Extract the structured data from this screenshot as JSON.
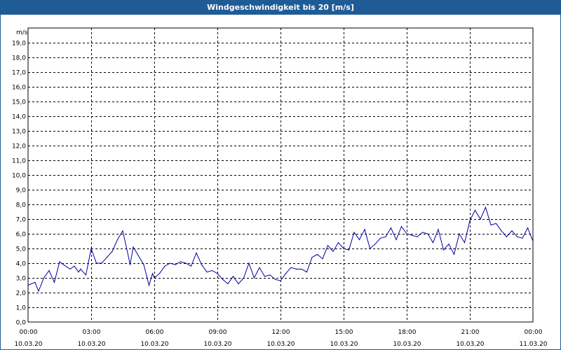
{
  "window": {
    "title": "Windgeschwindigkeit bis 20 [m/s]"
  },
  "colors": {
    "titlebar": "#1f5c96",
    "series": "#0000a0",
    "grid": "#000000"
  },
  "chart_data": {
    "type": "line",
    "title": "Windgeschwindigkeit bis 20 [m/s]",
    "ylabel": "m/s",
    "xlabel": "",
    "ylim": [
      0,
      20
    ],
    "xlim": [
      0,
      24
    ],
    "grid": true,
    "y_ticks": [
      "0,0",
      "1,0",
      "2,0",
      "3,0",
      "4,0",
      "5,0",
      "6,0",
      "7,0",
      "8,0",
      "9,0",
      "10,0",
      "11,0",
      "12,0",
      "13,0",
      "14,0",
      "15,0",
      "16,0",
      "17,0",
      "18,0",
      "19,0"
    ],
    "x_ticks": [
      {
        "time": "00:00",
        "date": "10.03.20"
      },
      {
        "time": "03:00",
        "date": "10.03.20"
      },
      {
        "time": "06:00",
        "date": "10.03.20"
      },
      {
        "time": "09:00",
        "date": "10.03.20"
      },
      {
        "time": "12:00",
        "date": "10.03.20"
      },
      {
        "time": "15:00",
        "date": "10.03.20"
      },
      {
        "time": "18:00",
        "date": "10.03.20"
      },
      {
        "time": "21:00",
        "date": "10.03.20"
      },
      {
        "time": "00:00",
        "date": "11.03.20"
      }
    ],
    "series": [
      {
        "x": [
          0,
          0.33,
          0.5,
          0.75,
          1.0,
          1.25,
          1.5,
          1.58,
          2.0,
          2.2,
          2.4,
          2.5,
          2.75,
          3.0,
          3.25,
          3.5,
          3.75,
          4.0,
          4.25,
          4.5,
          4.75,
          4.85,
          5.0,
          5.25,
          5.5,
          5.75,
          5.92,
          6.0,
          6.25,
          6.5,
          6.75,
          7.0,
          7.25,
          7.5,
          7.75,
          8.0,
          8.25,
          8.5,
          8.75,
          9.0,
          9.25,
          9.5,
          9.75,
          10.0,
          10.25,
          10.5,
          10.75,
          11.0,
          11.25,
          11.5,
          11.75,
          12.0,
          12.25,
          12.5,
          12.75,
          13.0,
          13.25,
          13.5,
          13.75,
          14.0,
          14.25,
          14.5,
          14.75,
          15.0,
          15.25,
          15.5,
          15.75,
          16.0,
          16.25,
          16.5,
          16.75,
          17.0,
          17.25,
          17.5,
          17.75,
          18.0,
          18.25,
          18.5,
          18.75,
          19.0,
          19.25,
          19.5,
          19.75,
          20.0,
          20.25,
          20.5,
          20.75,
          21.0,
          21.25,
          21.5,
          21.75,
          22.0,
          22.25,
          22.5,
          22.75,
          23.0,
          23.25,
          23.5,
          23.75,
          24.0
        ],
        "y": [
          2.5,
          2.7,
          2.1,
          3.0,
          3.5,
          2.7,
          4.1,
          4.0,
          3.6,
          3.8,
          3.4,
          3.6,
          3.2,
          5.0,
          4.0,
          4.0,
          4.4,
          4.8,
          5.6,
          6.2,
          4.6,
          3.9,
          5.1,
          4.5,
          3.9,
          2.5,
          3.3,
          3.0,
          3.3,
          3.8,
          4.0,
          3.9,
          4.1,
          4.0,
          3.8,
          4.7,
          3.9,
          3.4,
          3.5,
          3.3,
          2.9,
          2.6,
          3.1,
          2.6,
          3.0,
          4.0,
          3.0,
          3.7,
          3.1,
          3.2,
          2.9,
          2.8,
          3.3,
          3.7,
          3.6,
          3.6,
          3.4,
          4.4,
          4.6,
          4.3,
          5.2,
          4.8,
          5.4,
          5.0,
          4.9,
          6.1,
          5.6,
          6.3,
          5.0,
          5.3,
          5.7,
          5.8,
          6.4,
          5.6,
          6.5,
          6.0,
          5.9,
          5.8,
          6.1,
          6.0,
          5.4,
          6.3,
          4.9,
          5.3,
          4.6,
          6.0,
          5.4,
          6.9,
          7.6,
          7.0,
          7.8,
          6.6,
          6.7,
          6.2,
          5.8,
          6.2,
          5.8,
          5.7,
          6.4,
          5.5
        ],
        "color": "#0000a0"
      }
    ]
  }
}
